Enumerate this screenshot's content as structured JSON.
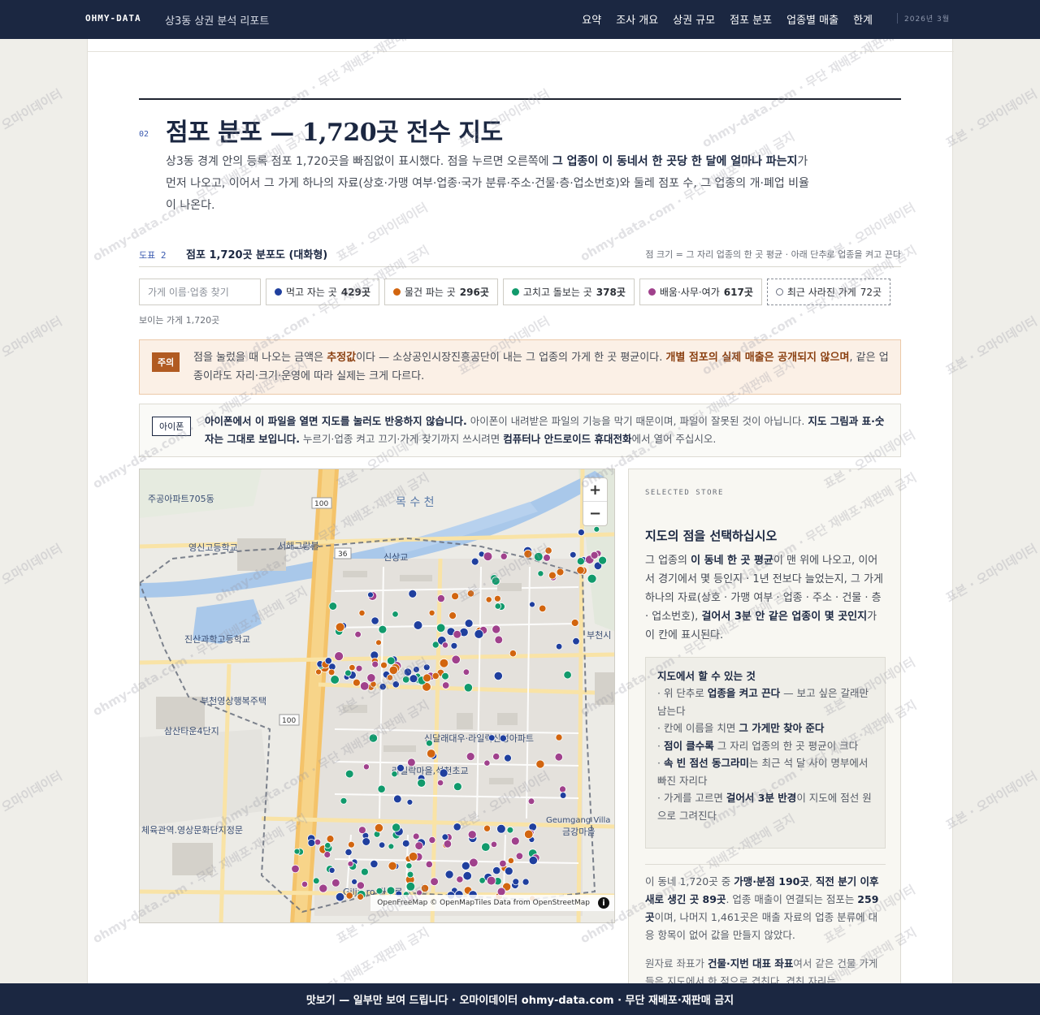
{
  "header": {
    "brand": "OHMY-DATA",
    "subtitle": "상3동 상권 분석 리포트",
    "nav": [
      "요약",
      "조사 개요",
      "상권 규모",
      "점포 분포",
      "업종별 매출",
      "한계"
    ],
    "date": "2026년 3월"
  },
  "section": {
    "number": "02",
    "title": "점포 분포 — 1,720곳 전수 지도",
    "intro": {
      "p1": "상3동 경계 안의 등록 점포 1,720곳을 빠짐없이 표시했다. 점을 누르면 오른쪽에 ",
      "b1": "그 업종이 이 동네서 한 곳당 한 달에 얼마나 파는지",
      "p2": "가 먼저 나오고, 이어서 그 가게 하나의 자료(상호·가맹 여부·업종·국가 분류·주소·건물·층·업소번호)와 둘레 점포 수, 그 업종의 개·폐업 비율이 나온다."
    }
  },
  "figure": {
    "label": "도표 2",
    "title": "점포 1,720곳 분포도 (대화형)",
    "note": "점 크기 = 그 자리 업종의 한 곳 평균 · 아래 단추로 업종을 켜고 끈다"
  },
  "filters": {
    "search_placeholder": "가게 이름·업종 찾기",
    "chips": [
      {
        "label": "먹고 자는 곳",
        "count": "429곳",
        "color": "#1f3f9e"
      },
      {
        "label": "물건 파는 곳",
        "count": "296곳",
        "color": "#d2650f"
      },
      {
        "label": "고치고 돌보는 곳",
        "count": "378곳",
        "color": "#119a6c"
      },
      {
        "label": "배움·사무·여가",
        "count": "617곳",
        "color": "#a0418c"
      }
    ],
    "closed": {
      "label": "최근 사라진 가게",
      "count": "72곳"
    },
    "visible_count": "보이는 가게 1,720곳"
  },
  "caution": {
    "tag": "주의",
    "t1": "점을 눌렀을 때 나오는 금액은 ",
    "b1": "추정값",
    "t2": "이다 — 소상공인시장진흥공단이 내는 그 업종의 가게 한 곳 평균이다. ",
    "b2": "개별 점포의 실제 매출은 공개되지 않으며",
    "t3": ", 같은 업종이라도 자리·크기·운영에 따라 실제는 크게 다르다."
  },
  "iphone": {
    "tag": "아이폰",
    "b1": "아이폰에서 이 파일을 열면 지도를 눌러도 반응하지 않습니다.",
    "t1": " 아이폰이 내려받은 파일의 기능을 막기 때문이며, 파일이 잘못된 것이 아닙니다. ",
    "b2": "지도 그림과 표·숫자는 그대로 보입니다.",
    "t2": " 누르기·업종 켜고 끄기·가게 찾기까지 쓰시려면 ",
    "b3": "컴퓨터나 안드로이드 휴대전화",
    "t3": "에서 열어 주십시오."
  },
  "map": {
    "zoom_in": "+",
    "zoom_out": "−",
    "attribution": "OpenFreeMap © OpenMapTiles Data from OpenStreetMap",
    "info": "i",
    "labels": {
      "mok": "목 수 천",
      "apt705": "주공아파트705동",
      "school1": "영신고등학교",
      "seohae": "서해그랑블",
      "sinsang": "신상교",
      "science": "진산과학고등학교",
      "bucheon": "부천영상행복주택",
      "samsan": "삼산타운4단지",
      "silla": "신달래대우·라일락신성아파트",
      "lilac": "라일락마을,석천초교",
      "sports": "체육관역.영상문화단지정문",
      "geumgang": "Geumgang Villa",
      "geumgang_kr": "금강마을",
      "gilju": "Gilju-ro 길주로",
      "bucheon_city": "부천시",
      "r100a": "100",
      "r36": "36",
      "r100b": "100"
    }
  },
  "panel": {
    "eyebrow": "SELECTED STORE",
    "title": "지도의 점을 선택하십시오",
    "body": {
      "t1": "그 업종의 ",
      "b1": "이 동네 한 곳 평균",
      "t2": "이 맨 위에 나오고, 이어서 경기에서 몇 등인지 · 1년 전보다 늘었는지, 그 가게 하나의 자료(상호 · 가맹 여부 · 업종 · 주소 · 건물 · 층 · 업소번호), ",
      "b2": "걸어서 3분 안 같은 업종이 몇 곳인지",
      "t3": "가 이 칸에 표시된다."
    },
    "howto": {
      "title": "지도에서 할 수 있는 것",
      "i1a": "· 위 단추로 ",
      "i1b": "업종을 켜고 끈다",
      "i1c": " — 보고 싶은 갈래만 남는다",
      "i2a": "· 칸에 이름을 치면 ",
      "i2b": "그 가게만 찾아 준다",
      "i2c": "",
      "i3a": "· ",
      "i3b": "점이 클수록",
      "i3c": " 그 자리 업종의 한 곳 평균이 크다",
      "i4a": "· ",
      "i4b": "속 빈 점선 동그라미",
      "i4c": "는 최근 석 달 사이 명부에서 빠진 자리다",
      "i5a": "· 가게를 고르면 ",
      "i5b": "걸어서 3분 반경",
      "i5c": "이 지도에 점선 원으로 그려진다"
    },
    "stat": {
      "t1": "이 동네 1,720곳 중 ",
      "b1": "가맹·분점 190곳",
      "t2": ", ",
      "b2": "직전 분기 이후 새로 생긴 곳 89곳",
      "t3": ". 업종 매출이 연결되는 점포는 ",
      "b3": "259곳",
      "t4": "이며, 나머지 1,461곳은 매출 자료의 업종 분류에 대응 항목이 없어 값을 만들지 않았다."
    },
    "note": {
      "t1": "원자료 좌표가 ",
      "b1": "건물·지번 대표 좌표",
      "t2": "여서 같은 건물 가게들은 지도에서 한 점으로 겹친다. 겹친 자리는"
    }
  },
  "banner": "맛보기 — 일부만 보여 드립니다 · 오마이데이터 ohmy-data.com · 무단 재배포·재판매 금지",
  "watermark": [
    "표본 · 오마이데이터",
    "ohmy-data.com · 무단 재배포·재판매 금지"
  ],
  "category_colors": {
    "food": "#1f3f9e",
    "retail": "#d2650f",
    "care": "#119a6c",
    "office": "#a0418c"
  }
}
